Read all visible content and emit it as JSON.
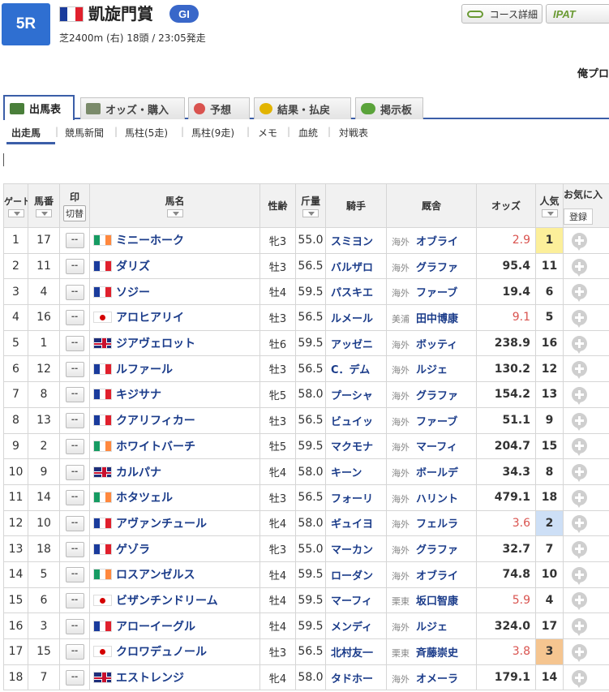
{
  "race": {
    "number": "5R",
    "name": "凱旋門賞",
    "grade": "GI",
    "info": "芝2400m (右) 18頭 / 23:05発走",
    "flag_colors": [
      "#1a3b9c",
      "#ffffff",
      "#e0202d"
    ]
  },
  "header": {
    "course_label": "コース詳細",
    "ipat_label": "IPAT",
    "right_cut_text": "俺プロ"
  },
  "tabs": [
    {
      "label": "出馬表",
      "icon": "table-icon"
    },
    {
      "label": "オッズ・購入",
      "icon": "odds-icon"
    },
    {
      "label": "予想",
      "icon": "target-icon"
    },
    {
      "label": "結果・払戻",
      "icon": "coins-icon"
    },
    {
      "label": "掲示板",
      "icon": "chat-icon"
    }
  ],
  "subnav": [
    "出走馬",
    "競馬新聞",
    "馬柱(5走)",
    "馬柱(9走)",
    "メモ",
    "血統",
    "対戦表"
  ],
  "table": {
    "headers": {
      "gate": "ゲート",
      "horse_no": "馬番",
      "mark": "印",
      "mark_toggle": "切替",
      "horse_name": "馬名",
      "sex_age": "性齢",
      "weight": "斤量",
      "jockey": "騎手",
      "stable": "厩舎",
      "odds": "オッズ",
      "popularity": "人気",
      "favorite": "お気に入",
      "register": "登録"
    },
    "mark_placeholder": "--",
    "rows": [
      {
        "gate": "1",
        "no": "17",
        "flag": "ie",
        "name": "ミニーホーク",
        "sexage": "牝3",
        "weight": "55.0",
        "jockey": "スミヨン",
        "area": "海外",
        "trainer": "オブライ",
        "odds": "2.9",
        "pop": "1"
      },
      {
        "gate": "2",
        "no": "11",
        "flag": "fr",
        "name": "ダリズ",
        "sexage": "牡3",
        "weight": "56.5",
        "jockey": "バルザロ",
        "area": "海外",
        "trainer": "グラファ",
        "odds": "95.4",
        "pop": "11"
      },
      {
        "gate": "3",
        "no": "4",
        "flag": "fr",
        "name": "ソジー",
        "sexage": "牡4",
        "weight": "59.5",
        "jockey": "パスキエ",
        "area": "海外",
        "trainer": "ファーブ",
        "odds": "19.4",
        "pop": "6"
      },
      {
        "gate": "4",
        "no": "16",
        "flag": "jp",
        "name": "アロヒアリイ",
        "sexage": "牡3",
        "weight": "56.5",
        "jockey": "ルメール",
        "area": "美浦",
        "trainer": "田中博康",
        "odds": "9.1",
        "pop": "5"
      },
      {
        "gate": "5",
        "no": "1",
        "flag": "gb",
        "name": "ジアヴェロット",
        "sexage": "牡6",
        "weight": "59.5",
        "jockey": "アッゼニ",
        "area": "海外",
        "trainer": "ボッティ",
        "odds": "238.9",
        "pop": "16"
      },
      {
        "gate": "6",
        "no": "12",
        "flag": "fr",
        "name": "ルファール",
        "sexage": "牡3",
        "weight": "56.5",
        "jockey": "C．デム",
        "area": "海外",
        "trainer": "ルジェ",
        "odds": "130.2",
        "pop": "12"
      },
      {
        "gate": "7",
        "no": "8",
        "flag": "fr",
        "name": "キジサナ",
        "sexage": "牝5",
        "weight": "58.0",
        "jockey": "プーシャ",
        "area": "海外",
        "trainer": "グラファ",
        "odds": "154.2",
        "pop": "13"
      },
      {
        "gate": "8",
        "no": "13",
        "flag": "fr",
        "name": "クアリフィカー",
        "sexage": "牡3",
        "weight": "56.5",
        "jockey": "ビュイッ",
        "area": "海外",
        "trainer": "ファーブ",
        "odds": "51.1",
        "pop": "9"
      },
      {
        "gate": "9",
        "no": "2",
        "flag": "ie",
        "name": "ホワイトバーチ",
        "sexage": "牡5",
        "weight": "59.5",
        "jockey": "マクモナ",
        "area": "海外",
        "trainer": "マーフィ",
        "odds": "204.7",
        "pop": "15"
      },
      {
        "gate": "10",
        "no": "9",
        "flag": "gb",
        "name": "カルパナ",
        "sexage": "牝4",
        "weight": "58.0",
        "jockey": "キーン",
        "area": "海外",
        "trainer": "ボールデ",
        "odds": "34.3",
        "pop": "8"
      },
      {
        "gate": "11",
        "no": "14",
        "flag": "ie",
        "name": "ホタツェル",
        "sexage": "牡3",
        "weight": "56.5",
        "jockey": "フォーリ",
        "area": "海外",
        "trainer": "ハリント",
        "odds": "479.1",
        "pop": "18"
      },
      {
        "gate": "12",
        "no": "10",
        "flag": "fr",
        "name": "アヴァンチュール",
        "sexage": "牝4",
        "weight": "58.0",
        "jockey": "ギュイヨ",
        "area": "海外",
        "trainer": "フェルラ",
        "odds": "3.6",
        "pop": "2"
      },
      {
        "gate": "13",
        "no": "18",
        "flag": "fr",
        "name": "ゲゾラ",
        "sexage": "牝3",
        "weight": "55.0",
        "jockey": "マーカン",
        "area": "海外",
        "trainer": "グラファ",
        "odds": "32.7",
        "pop": "7"
      },
      {
        "gate": "14",
        "no": "5",
        "flag": "ie",
        "name": "ロスアンゼルス",
        "sexage": "牡4",
        "weight": "59.5",
        "jockey": "ローダン",
        "area": "海外",
        "trainer": "オブライ",
        "odds": "74.8",
        "pop": "10"
      },
      {
        "gate": "15",
        "no": "6",
        "flag": "jp",
        "name": "ビザンチンドリーム",
        "sexage": "牡4",
        "weight": "59.5",
        "jockey": "マーフィ",
        "area": "栗東",
        "trainer": "坂口智康",
        "odds": "5.9",
        "pop": "4"
      },
      {
        "gate": "16",
        "no": "3",
        "flag": "fr",
        "name": "アローイーグル",
        "sexage": "牡4",
        "weight": "59.5",
        "jockey": "メンディ",
        "area": "海外",
        "trainer": "ルジェ",
        "odds": "324.0",
        "pop": "17"
      },
      {
        "gate": "17",
        "no": "15",
        "flag": "jp",
        "name": "クロワデュノール",
        "sexage": "牡3",
        "weight": "56.5",
        "jockey": "北村友一",
        "area": "栗東",
        "trainer": "斉藤崇史",
        "odds": "3.8",
        "pop": "3"
      },
      {
        "gate": "18",
        "no": "7",
        "flag": "gb",
        "name": "エストレンジ",
        "sexage": "牝4",
        "weight": "58.0",
        "jockey": "タドホー",
        "area": "海外",
        "trainer": "オメーラ",
        "odds": "179.1",
        "pop": "14"
      }
    ]
  },
  "colors": {
    "accent": "#2f6fd1",
    "tab_border": "#3b5ea8",
    "link": "#1b3c8a",
    "hot_odds": "#d9534f",
    "pop1": "#fcef9a",
    "pop2": "#cddff6",
    "pop3": "#f5c590"
  }
}
